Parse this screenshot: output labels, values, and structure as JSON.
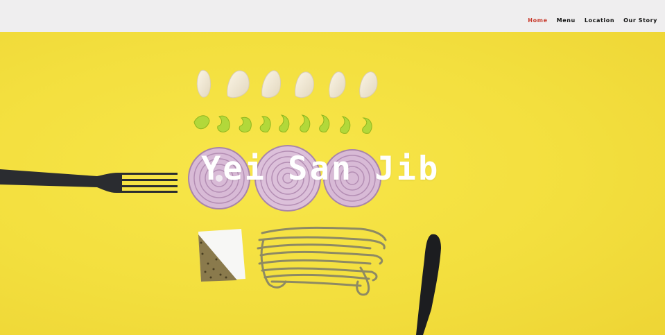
{
  "nav": {
    "items": [
      {
        "label": "Home",
        "active": true
      },
      {
        "label": "Menu",
        "active": false
      },
      {
        "label": "Location",
        "active": false
      },
      {
        "label": "Our Story",
        "active": false
      }
    ]
  },
  "hero": {
    "title": "Yei San Jib",
    "background_color": "#f2df3c"
  },
  "colors": {
    "nav_background": "#efeeef",
    "nav_active": "#c8392b",
    "nav_text": "#111111"
  }
}
